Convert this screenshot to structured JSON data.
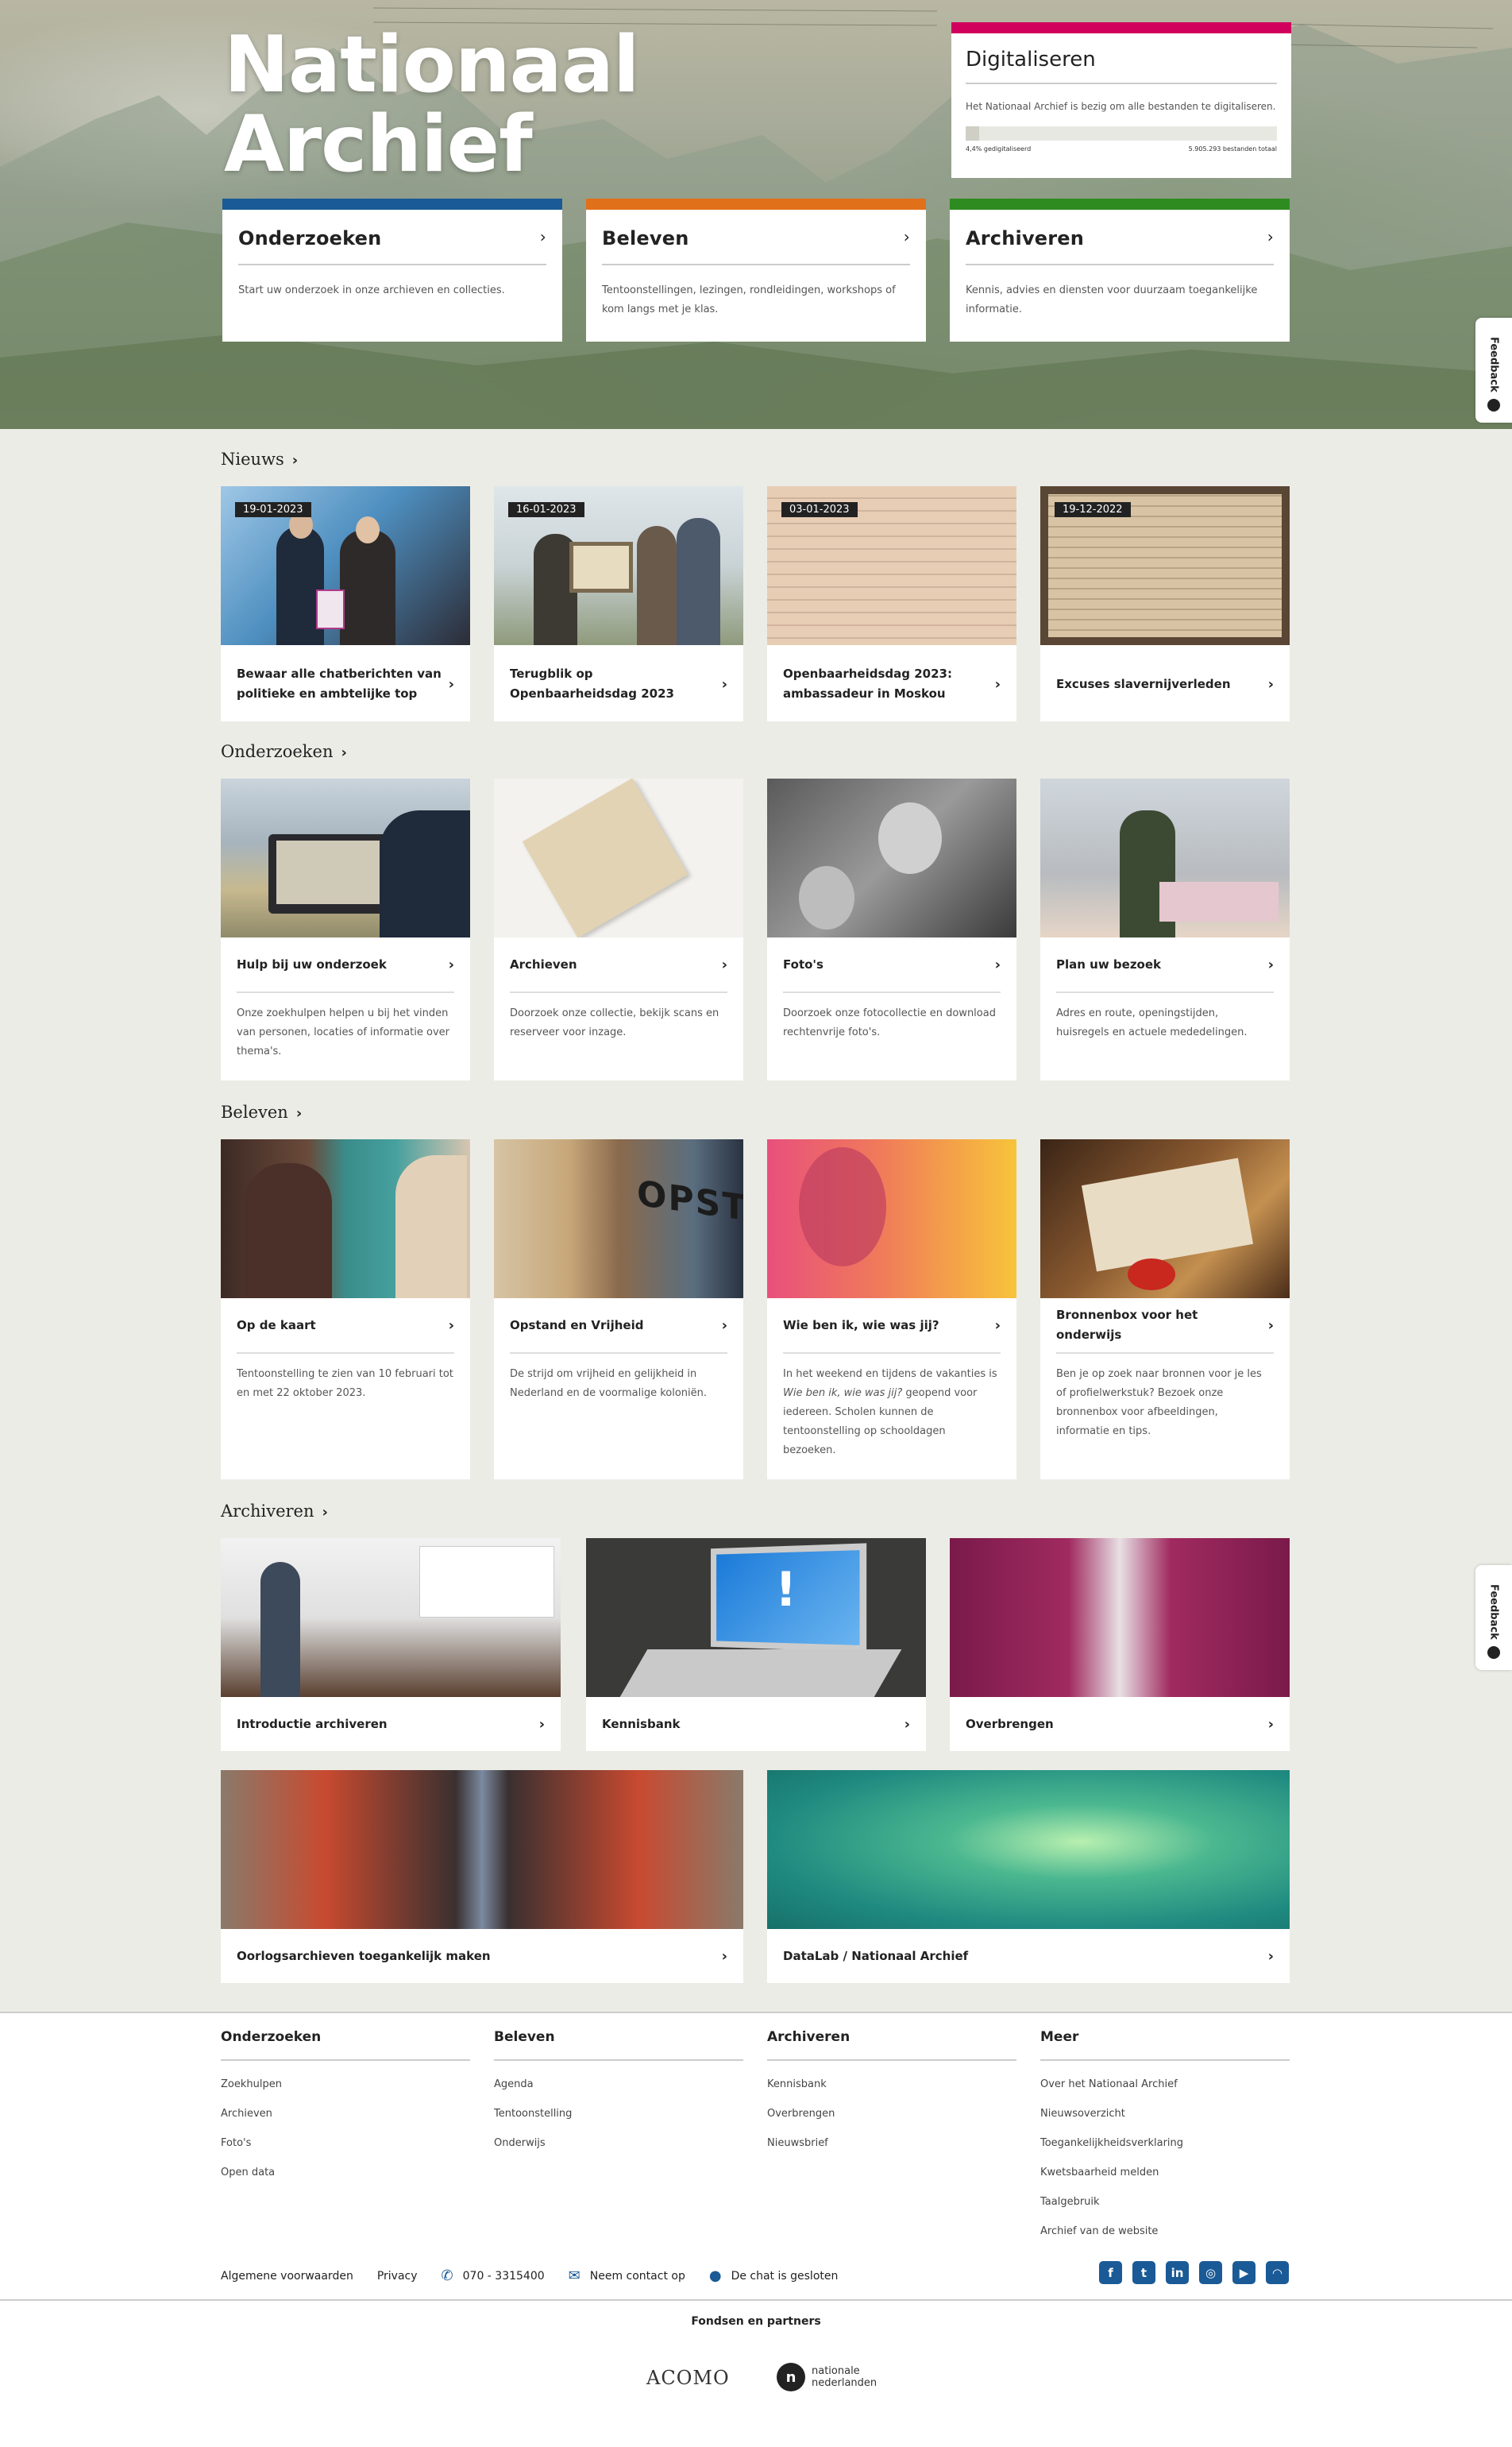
{
  "hero": {
    "title_line1": "Nationaal",
    "title_line2": "Archief",
    "digitaliseren": {
      "title": "Digitaliseren",
      "text": "Het Nationaal Archief is bezig om alle bestanden te digitaliseren.",
      "progress_label": "4,4% gedigitaliseerd",
      "progress_fraction": 0.044,
      "total_label": "5.905.293 bestanden totaal"
    },
    "cards": [
      {
        "title": "Onderzoeken",
        "text": "Start uw onderzoek in onze archieven en collecties.",
        "color": "#1a5a96"
      },
      {
        "title": "Beleven",
        "text": "Tentoonstellingen, lezingen, rondleidingen, workshops of kom langs met je klas.",
        "color": "#e1701b"
      },
      {
        "title": "Archiveren",
        "text": "Kennis, advies en diensten voor duurzaam toegankelijke informatie.",
        "color": "#2e8b1f"
      }
    ],
    "feedback_label": "Feedback"
  },
  "nieuws": {
    "heading": "Nieuws",
    "items": [
      {
        "date": "19-01-2023",
        "title": "Bewaar alle chatberichten van politieke en ambtelijke top"
      },
      {
        "date": "16-01-2023",
        "title": "Terugblik op Openbaarheidsdag 2023"
      },
      {
        "date": "03-01-2023",
        "title": "Openbaarheidsdag 2023: ambassadeur in Moskou"
      },
      {
        "date": "19-12-2022",
        "title": "Excuses slavernijverleden"
      }
    ]
  },
  "onderzoeken": {
    "heading": "Onderzoeken",
    "items": [
      {
        "title": "Hulp bij uw onderzoek",
        "text": "Onze zoekhulpen helpen u bij het vinden van personen, locaties of informatie over thema's."
      },
      {
        "title": "Archieven",
        "text": "Doorzoek onze collectie, bekijk scans en reserveer voor inzage."
      },
      {
        "title": "Foto's",
        "text": "Doorzoek onze fotocollectie en download rechtenvrije foto's."
      },
      {
        "title": "Plan uw bezoek",
        "text": "Adres en route, openingstijden, huisregels en actuele mededelingen."
      }
    ]
  },
  "beleven": {
    "heading": "Beleven",
    "items": [
      {
        "title": "Op de kaart",
        "text": "Tentoonstelling te zien van 10 februari tot en met 22 oktober 2023."
      },
      {
        "title": "Opstand en Vrijheid",
        "text": "De strijd om vrijheid en gelijkheid in Nederland en de voormalige koloniën."
      },
      {
        "title": "Wie ben ik, wie was jij?",
        "text_pre": "In het weekend en tijdens de vakanties is ",
        "text_em": "Wie ben ik, wie was jij?",
        "text_post": " geopend voor iedereen. Scholen kunnen de tentoonstelling op schooldagen bezoeken."
      },
      {
        "title": "Bronnenbox voor het onderwijs",
        "text": "Ben je op zoek naar bronnen voor je les of profielwerkstuk? Bezoek onze bronnenbox voor afbeeldingen, informatie en tips."
      }
    ]
  },
  "archiveren": {
    "heading": "Archiveren",
    "items": [
      {
        "title": "Introductie archiveren"
      },
      {
        "title": "Kennisbank"
      },
      {
        "title": "Overbrengen"
      },
      {
        "title": "Oorlogsarchieven toegankelijk maken"
      },
      {
        "title": "DataLab / Nationaal Archief"
      }
    ]
  },
  "footer": {
    "columns": [
      {
        "title": "Onderzoeken",
        "links": [
          "Zoekhulpen",
          "Archieven",
          "Foto's",
          "Open data"
        ]
      },
      {
        "title": "Beleven",
        "links": [
          "Agenda",
          "Tentoonstelling",
          "Onderwijs"
        ]
      },
      {
        "title": "Archiveren",
        "links": [
          "Kennisbank",
          "Overbrengen",
          "Nieuwsbrief"
        ]
      },
      {
        "title": "Meer",
        "links": [
          "Over het Nationaal Archief",
          "Nieuwsoverzicht",
          "Toegankelijkheidsverklaring",
          "Kwetsbaarheid melden",
          "Taalgebruik",
          "Archief van de website"
        ]
      }
    ],
    "bar": {
      "terms": "Algemene voorwaarden",
      "privacy": "Privacy",
      "phone": "070 - 3315400",
      "contact": "Neem contact op",
      "chat": "De chat is gesloten"
    },
    "social_icons": [
      "facebook-icon",
      "twitter-icon",
      "linkedin-icon",
      "instagram-icon",
      "youtube-icon",
      "rss-icon"
    ],
    "partners_heading": "Fondsen en partners",
    "partner1": "ACOMO",
    "partner2_line1": "nationale",
    "partner2_line2": "nederlanden"
  },
  "colors": {
    "accent": "#1a5a96",
    "digitaliseren": "#d1005c"
  }
}
